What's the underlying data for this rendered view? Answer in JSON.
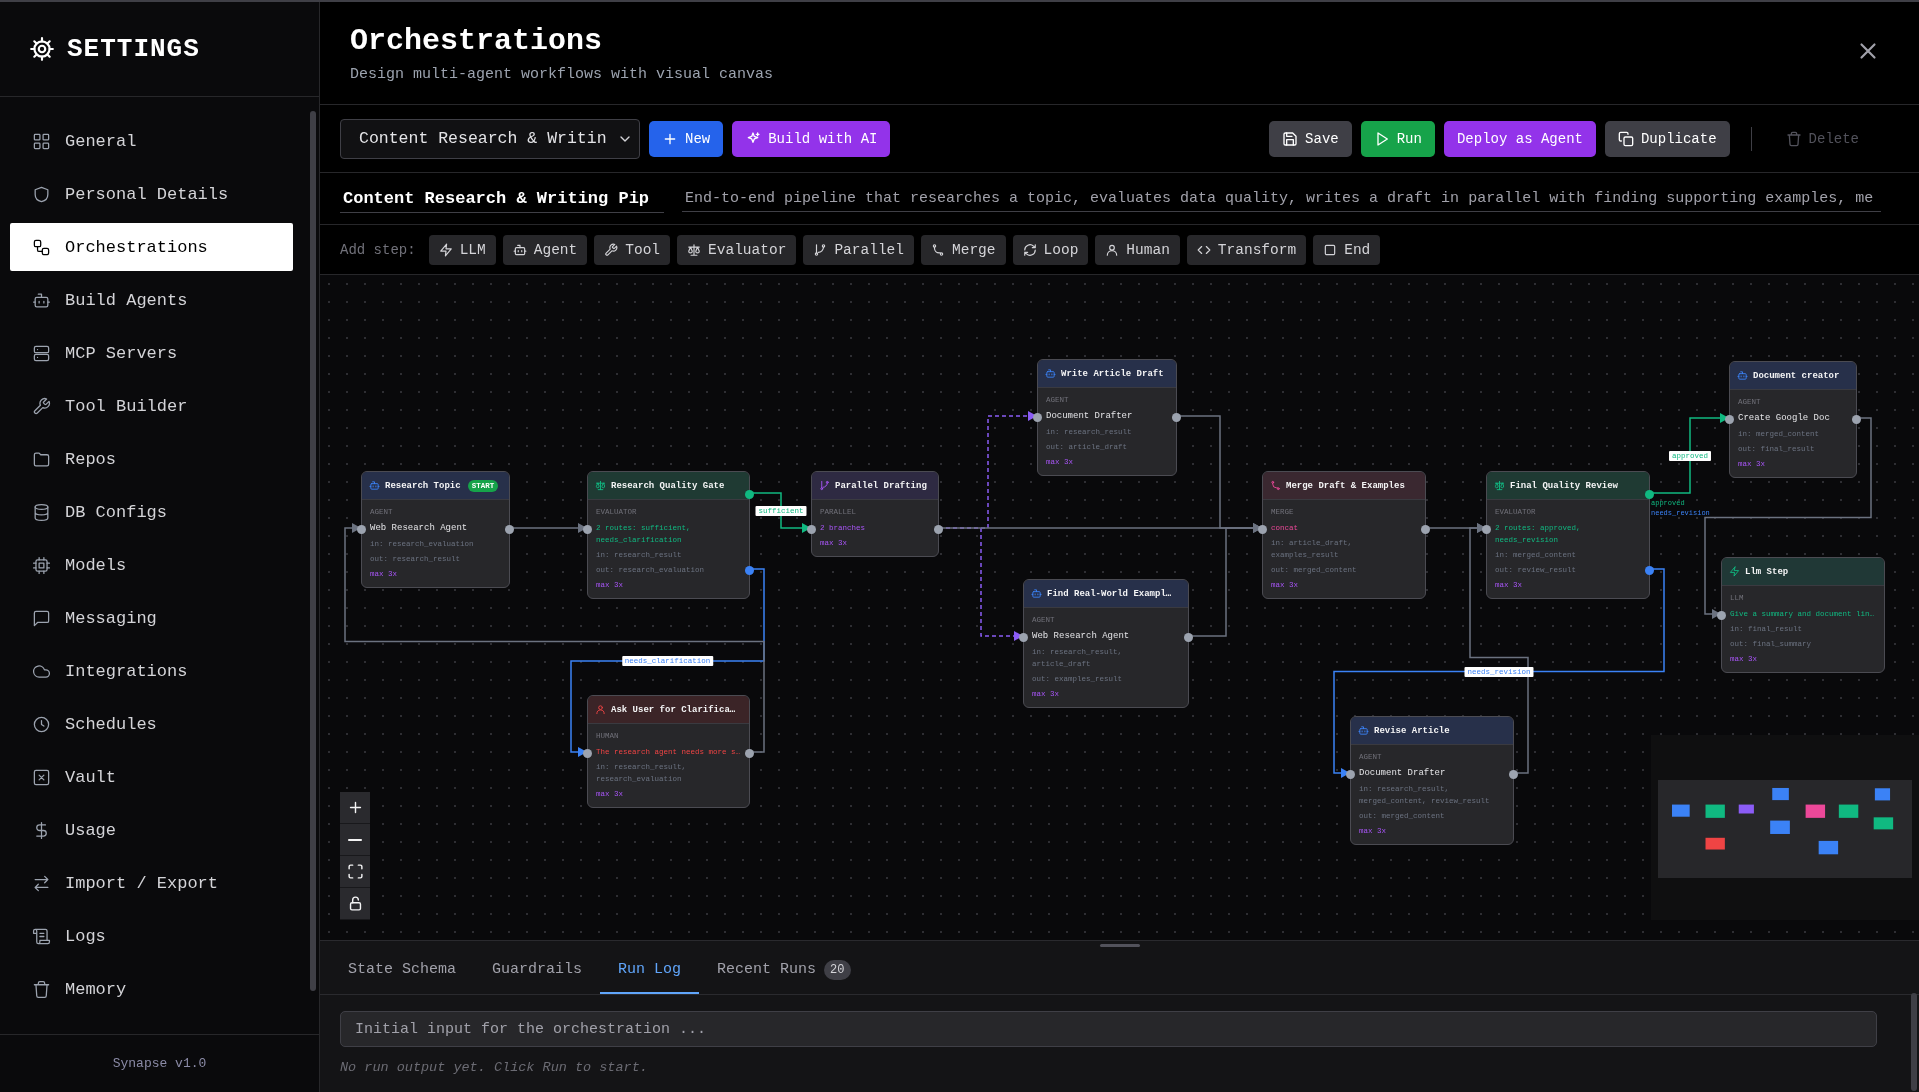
{
  "sidebar": {
    "title": "SETTINGS",
    "items": [
      {
        "label": "General",
        "selected": false
      },
      {
        "label": "Personal Details",
        "selected": false
      },
      {
        "label": "Orchestrations",
        "selected": true
      },
      {
        "label": "Build Agents",
        "selected": false
      },
      {
        "label": "MCP Servers",
        "selected": false
      },
      {
        "label": "Tool Builder",
        "selected": false
      },
      {
        "label": "Repos",
        "selected": false
      },
      {
        "label": "DB Configs",
        "selected": false
      },
      {
        "label": "Models",
        "selected": false
      },
      {
        "label": "Messaging",
        "selected": false
      },
      {
        "label": "Integrations",
        "selected": false
      },
      {
        "label": "Schedules",
        "selected": false
      },
      {
        "label": "Vault",
        "selected": false
      },
      {
        "label": "Usage",
        "selected": false
      },
      {
        "label": "Import / Export",
        "selected": false
      },
      {
        "label": "Logs",
        "selected": false
      },
      {
        "label": "Memory",
        "selected": false
      }
    ],
    "footer": "Synapse v1.0"
  },
  "header": {
    "title": "Orchestrations",
    "subtitle": "Design multi-agent workflows with visual canvas"
  },
  "toolbar": {
    "workflow_select": {
      "value": "Content Research & Writin"
    },
    "buttons": [
      {
        "label": "New",
        "kind": "new",
        "disabled": false
      },
      {
        "label": "Build with AI",
        "kind": "ai",
        "disabled": false
      },
      {
        "label": "Save",
        "kind": "save",
        "disabled": false
      },
      {
        "label": "Run",
        "kind": "run",
        "disabled": false
      },
      {
        "label": "Deploy as Agent",
        "kind": "deploy",
        "disabled": false
      },
      {
        "label": "Duplicate",
        "kind": "duplicate",
        "disabled": false
      },
      {
        "label": "Delete",
        "kind": "delete",
        "disabled": true
      }
    ]
  },
  "workflow": {
    "name": "Content Research & Writing Pip",
    "description": "End-to-end pipeline that researches a topic, evaluates data quality, writes a draft in parallel with finding supporting examples, me"
  },
  "add_step": {
    "label": "Add step:",
    "steps": [
      {
        "label": "LLM",
        "kind": "llm"
      },
      {
        "label": "Agent",
        "kind": "agent"
      },
      {
        "label": "Tool",
        "kind": "tool"
      },
      {
        "label": "Evaluator",
        "kind": "evaluator"
      },
      {
        "label": "Parallel",
        "kind": "parallel"
      },
      {
        "label": "Merge",
        "kind": "merge"
      },
      {
        "label": "Loop",
        "kind": "loop"
      },
      {
        "label": "Human",
        "kind": "human"
      },
      {
        "label": "Transform",
        "kind": "transform"
      },
      {
        "label": "End",
        "kind": "end"
      }
    ]
  },
  "canvas": {
    "nodes": [
      {
        "kind": "agent",
        "title": "Research Topic",
        "badge": "START",
        "kind_label": "AGENT",
        "detail": "Web Research Agent",
        "inputs": "in: research_evaluation",
        "outputs": "out: research_result",
        "max": "max 3x"
      },
      {
        "kind": "evaluator",
        "title": "Research Quality Gate",
        "kind_label": "EVALUATOR",
        "detail": "2 routes: sufficient, needs_clarification",
        "inputs": "in: research_result",
        "outputs": "out: research_evaluation",
        "max": "max 3x"
      },
      {
        "kind": "human",
        "title": "Ask User for Clarifica…",
        "kind_label": "HUMAN",
        "detail": "The research agent needs more s…",
        "inputs": "in: research_result, research_evaluation",
        "max": "max 3x"
      },
      {
        "kind": "parallel",
        "title": "Parallel Drafting",
        "kind_label": "PARALLEL",
        "detail": "2 branches",
        "max": "max 3x"
      },
      {
        "kind": "agent",
        "title": "Write Article Draft",
        "kind_label": "AGENT",
        "detail": "Document Drafter",
        "inputs": "in: research_result",
        "outputs": "out: article_draft",
        "max": "max 3x"
      },
      {
        "kind": "agent",
        "title": "Find Real-World Exampl…",
        "kind_label": "AGENT",
        "detail": "Web Research Agent",
        "inputs": "in: research_result, article_draft",
        "outputs": "out: examples_result",
        "max": "max 3x"
      },
      {
        "kind": "merge",
        "title": "Merge Draft & Examples",
        "kind_label": "MERGE",
        "detail": "concat",
        "inputs": "in: article_draft, examples_result",
        "outputs": "out: merged_content",
        "max": "max 3x"
      },
      {
        "kind": "evaluator",
        "title": "Final Quality Review",
        "kind_label": "EVALUATOR",
        "detail": "2 routes: approved, needs_revision",
        "inputs": "in: merged_content",
        "outputs": "out: review_result",
        "max": "max 3x",
        "port_labels": [
          "approved",
          "needs_revision"
        ]
      },
      {
        "kind": "agent",
        "title": "Revise Article",
        "kind_label": "AGENT",
        "detail": "Document Drafter",
        "inputs": "in: research_result, merged_content, review_result",
        "outputs": "out: merged_content",
        "max": "max 3x"
      },
      {
        "kind": "agent",
        "title": "Document creator",
        "kind_label": "AGENT",
        "detail": "Create Google Doc",
        "inputs": "in: merged_content",
        "outputs": "out: final_result",
        "max": "max 3x"
      },
      {
        "kind": "llm",
        "title": "Llm Step",
        "kind_label": "LLM",
        "detail": "Give a summary and document lin…",
        "inputs": "in: final_result",
        "outputs": "out: final_summary",
        "max": "max 3x"
      }
    ],
    "edges": [
      {
        "kind": "default"
      },
      {
        "kind": "route",
        "color": "#10b981",
        "label": "sufficient"
      },
      {
        "kind": "route",
        "color": "#3b82f6",
        "label": "needs_clarification"
      },
      {
        "kind": "default"
      },
      {
        "kind": "parallel"
      },
      {
        "kind": "parallel"
      },
      {
        "kind": "default"
      },
      {
        "kind": "default"
      },
      {
        "kind": "default"
      },
      {
        "kind": "default"
      },
      {
        "kind": "route",
        "color": "#10b981",
        "label": "approved"
      },
      {
        "kind": "route",
        "color": "#3b82f6",
        "label": "needs_revision"
      },
      {
        "kind": "default"
      },
      {
        "kind": "default"
      }
    ]
  },
  "bottom_panel": {
    "tabs": [
      {
        "label": "State Schema",
        "selected": false
      },
      {
        "label": "Guardrails",
        "selected": false
      },
      {
        "label": "Run Log",
        "selected": true
      },
      {
        "label": "Recent Runs",
        "badge": "20",
        "selected": false
      }
    ],
    "input": {
      "placeholder": "Initial input for the orchestration ..."
    },
    "empty_message": "No run output yet. Click Run to start."
  }
}
